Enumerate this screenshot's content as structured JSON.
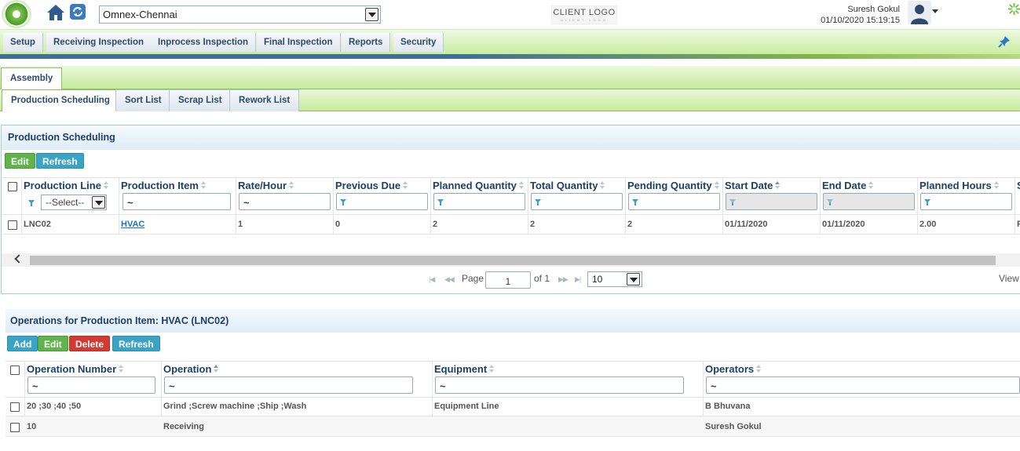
{
  "header": {
    "site_value": "Omnex-Chennai",
    "client_logo": "CLIENT LOGO",
    "client_logo_sub": "CLIENT LOGO",
    "user_name": "Suresh Gokul",
    "datetime": "01/10/2020 15:19:15",
    "icons": [
      "app-logo-icon",
      "home-icon",
      "refresh-icon",
      "avatar-icon",
      "gear-icon"
    ]
  },
  "menu": {
    "items": [
      "Setup",
      "Receiving Inspection",
      "Inprocess Inspection",
      "Final Inspection",
      "Reports",
      "Security"
    ],
    "pin_icon": "pin-icon"
  },
  "tabs": {
    "level1": [
      "Assembly"
    ],
    "level2": [
      "Production Scheduling",
      "Sort List",
      "Scrap List",
      "Rework List"
    ]
  },
  "production": {
    "title": "Production Scheduling",
    "buttons": {
      "edit": "Edit",
      "refresh": "Refresh"
    },
    "columns": [
      "Production Line",
      "Production Item",
      "Rate/Hour",
      "Previous Due",
      "Planned Quantity",
      "Total Quantity",
      "Pending Quantity",
      "Start Date",
      "End Date",
      "Planned Hours",
      "S"
    ],
    "line_filter_value": "--Select--",
    "filter_symbol": "~",
    "rows": [
      [
        "LNC02",
        "HVAC",
        "1",
        "0",
        "2",
        "2",
        "2",
        "01/11/2020",
        "01/11/2020",
        "2.00",
        "F"
      ]
    ],
    "pager": {
      "page_label": "Page",
      "page_value": "1",
      "of_label": "of 1",
      "page_size": "10",
      "view_label": "View"
    }
  },
  "operations": {
    "title": "Operations for Production Item: HVAC (LNC02)",
    "buttons": {
      "add": "Add",
      "edit": "Edit",
      "delete": "Delete",
      "refresh": "Refresh"
    },
    "columns": [
      "Operation Number",
      "Operation",
      "Equipment",
      "Operators"
    ],
    "filter_symbol": "~",
    "rows": [
      [
        "20 ;30 ;40 ;50",
        "Grind ;Screw machine ;Ship ;Wash",
        "Equipment Line",
        "B Bhuvana"
      ],
      [
        "10",
        "Receiving",
        "",
        "Suresh Gokul"
      ]
    ]
  },
  "colors": {
    "accent_green": "#61b34b",
    "accent_blue": "#3ba4c6",
    "danger_red": "#d23b34",
    "title_navy": "#1e3f66"
  }
}
